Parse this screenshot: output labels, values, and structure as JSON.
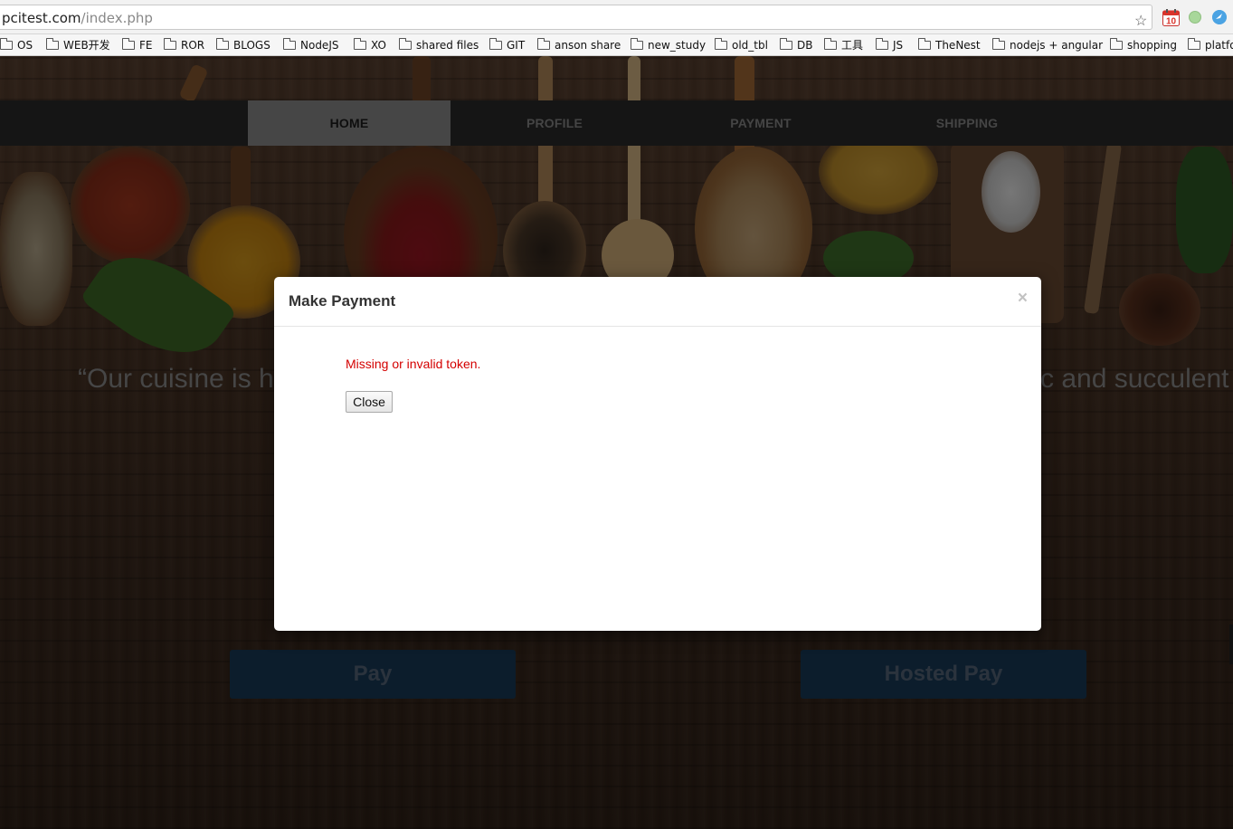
{
  "browser": {
    "url_host": "pcitest.com",
    "url_path": "/index.php",
    "bookmarks": [
      "OS",
      "WEB开发",
      "FE",
      "ROR",
      "BLOGS",
      "NodeJS",
      "XO",
      "shared files",
      "GIT",
      "anson share",
      "new_study",
      "old_tbl",
      "DB",
      "工具",
      "JS",
      "TheNest",
      "nodejs + angular",
      "shopping",
      "platfo"
    ],
    "calendar_badge": "10"
  },
  "nav": {
    "items": [
      "HOME",
      "PROFILE",
      "PAYMENT",
      "SHIPPING"
    ],
    "active": "HOME"
  },
  "hero": {
    "quote_left": "“Our cuisine is h",
    "quote_right": "c and succulent"
  },
  "buttons": {
    "pay": "Pay",
    "hosted_pay": "Hosted Pay"
  },
  "modal": {
    "title": "Make Payment",
    "close_symbol": "×",
    "error": "Missing or invalid token.",
    "close_button": "Close"
  },
  "colors": {
    "nav_bg": "#2b2b2b",
    "nav_active": "#8d8d8d",
    "error_text": "#d40000",
    "button_bg": "#183b58"
  }
}
